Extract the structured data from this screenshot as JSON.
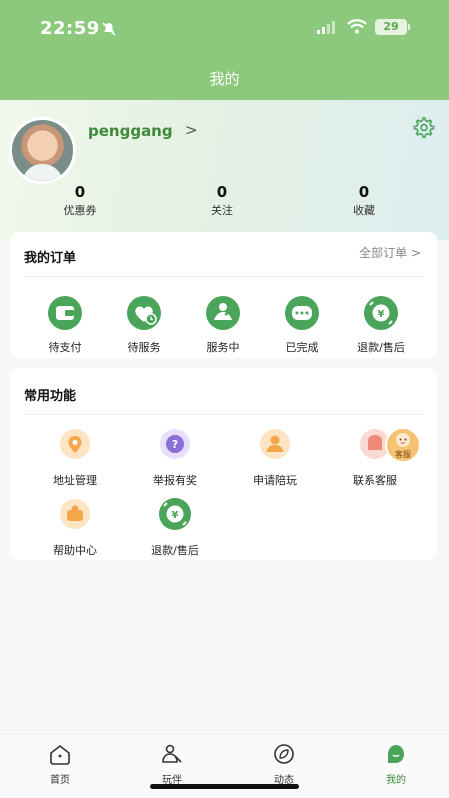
{
  "status_bar": {
    "time": "22:59",
    "battery": "29"
  },
  "header": {
    "title": "我的"
  },
  "profile": {
    "username": "penggang",
    "chevron": ">"
  },
  "stats": [
    {
      "value": "0",
      "label": "优惠券"
    },
    {
      "value": "0",
      "label": "关注"
    },
    {
      "value": "0",
      "label": "收藏"
    }
  ],
  "orders": {
    "title": "我的订单",
    "all_link": "全部订单 >",
    "items": [
      {
        "label": "待支付",
        "icon": "wallet-icon"
      },
      {
        "label": "待服务",
        "icon": "clock-icon"
      },
      {
        "label": "服务中",
        "icon": "service-icon"
      },
      {
        "label": "已完成",
        "icon": "chat-bubble-icon"
      },
      {
        "label": "退款/售后",
        "icon": "refund-icon"
      }
    ]
  },
  "functions": {
    "title": "常用功能",
    "items": [
      {
        "label": "地址管理",
        "icon": "location-icon"
      },
      {
        "label": "举报有奖",
        "icon": "report-icon"
      },
      {
        "label": "申请陪玩",
        "icon": "person-apply-icon"
      },
      {
        "label": "联系客服",
        "icon": "customer-service-icon"
      },
      {
        "label": "帮助中心",
        "icon": "help-center-icon"
      },
      {
        "label": "退款/售后",
        "icon": "refund-icon"
      }
    ],
    "service_badge": "客服"
  },
  "tabbar": {
    "items": [
      {
        "label": "首页"
      },
      {
        "label": "玩伴"
      },
      {
        "label": "动态"
      },
      {
        "label": "我的"
      }
    ]
  },
  "colors": {
    "brand_green": "#8dc97d",
    "icon_green": "#4aa55a",
    "orange": "#f4a64a",
    "purple": "#8b6fd6"
  }
}
